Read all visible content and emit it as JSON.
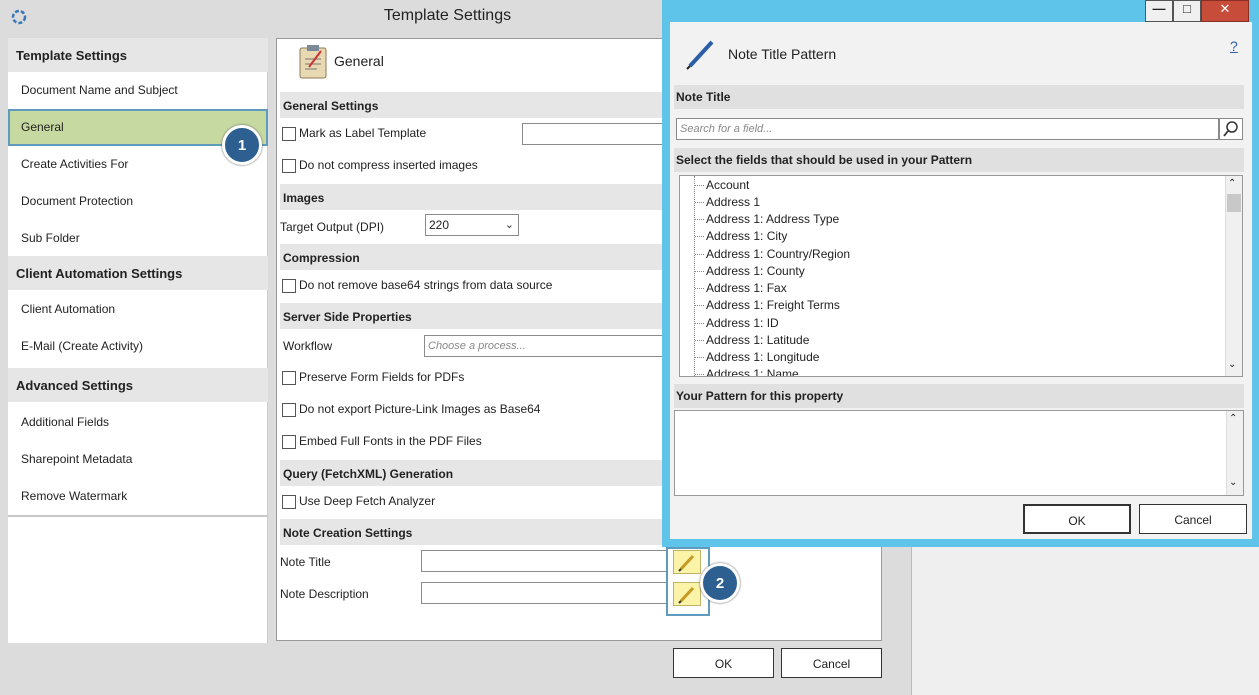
{
  "main": {
    "title": "Template Settings",
    "nav": {
      "sections": [
        {
          "heading": "Template Settings",
          "items": [
            "Document Name and Subject",
            "General",
            "Create Activities For",
            "Document Protection",
            "Sub Folder"
          ]
        },
        {
          "heading": "Client Automation Settings",
          "items": [
            "Client Automation",
            "E-Mail (Create Activity)"
          ]
        },
        {
          "heading": "Advanced Settings",
          "items": [
            "Additional Fields",
            "Sharepoint Metadata",
            "Remove Watermark"
          ]
        }
      ],
      "active_item": "General"
    },
    "content": {
      "page_title": "General",
      "general_settings": {
        "heading": "General Settings",
        "mark_label": "Mark as Label Template",
        "no_compress_label": "Do not compress inserted images"
      },
      "images": {
        "heading": "Images",
        "target_output_label": "Target Output (DPI)",
        "target_output_value": "220"
      },
      "compression": {
        "heading": "Compression",
        "no_remove_base64_label": "Do not remove base64 strings from data source"
      },
      "server_side": {
        "heading": "Server Side Properties",
        "workflow_label": "Workflow",
        "workflow_placeholder": "Choose a process...",
        "preserve_form_fields_label": "Preserve Form Fields for PDFs",
        "no_export_picture_label": "Do not export Picture-Link Images as Base64",
        "embed_fonts_label": "Embed Full Fonts in the PDF Files"
      },
      "query": {
        "heading": "Query (FetchXML) Generation",
        "deep_fetch_label": "Use Deep Fetch Analyzer"
      },
      "note_creation": {
        "heading": "Note Creation Settings",
        "note_title_label": "Note Title",
        "note_description_label": "Note Description"
      }
    },
    "ok_label": "OK",
    "cancel_label": "Cancel"
  },
  "badges": {
    "one": "1",
    "two": "2"
  },
  "dialog": {
    "title": "Note Title Pattern",
    "help": "?",
    "note_title_heading": "Note Title",
    "search_placeholder": "Search for a field...",
    "fields_heading": "Select the fields that should be used in your Pattern",
    "fields": [
      "Account",
      "Address 1",
      "Address 1: Address Type",
      "Address 1: City",
      "Address 1: Country/Region",
      "Address 1: County",
      "Address 1: Fax",
      "Address 1: Freight Terms",
      "Address 1: ID",
      "Address 1: Latitude",
      "Address 1: Longitude",
      "Address 1: Name"
    ],
    "pattern_heading": "Your Pattern for this property",
    "ok_label": "OK",
    "cancel_label": "Cancel"
  },
  "colors": {
    "dialog_frame": "#5ec4ea",
    "active_nav": "#c6d9a0",
    "badge": "#2d5f91"
  }
}
